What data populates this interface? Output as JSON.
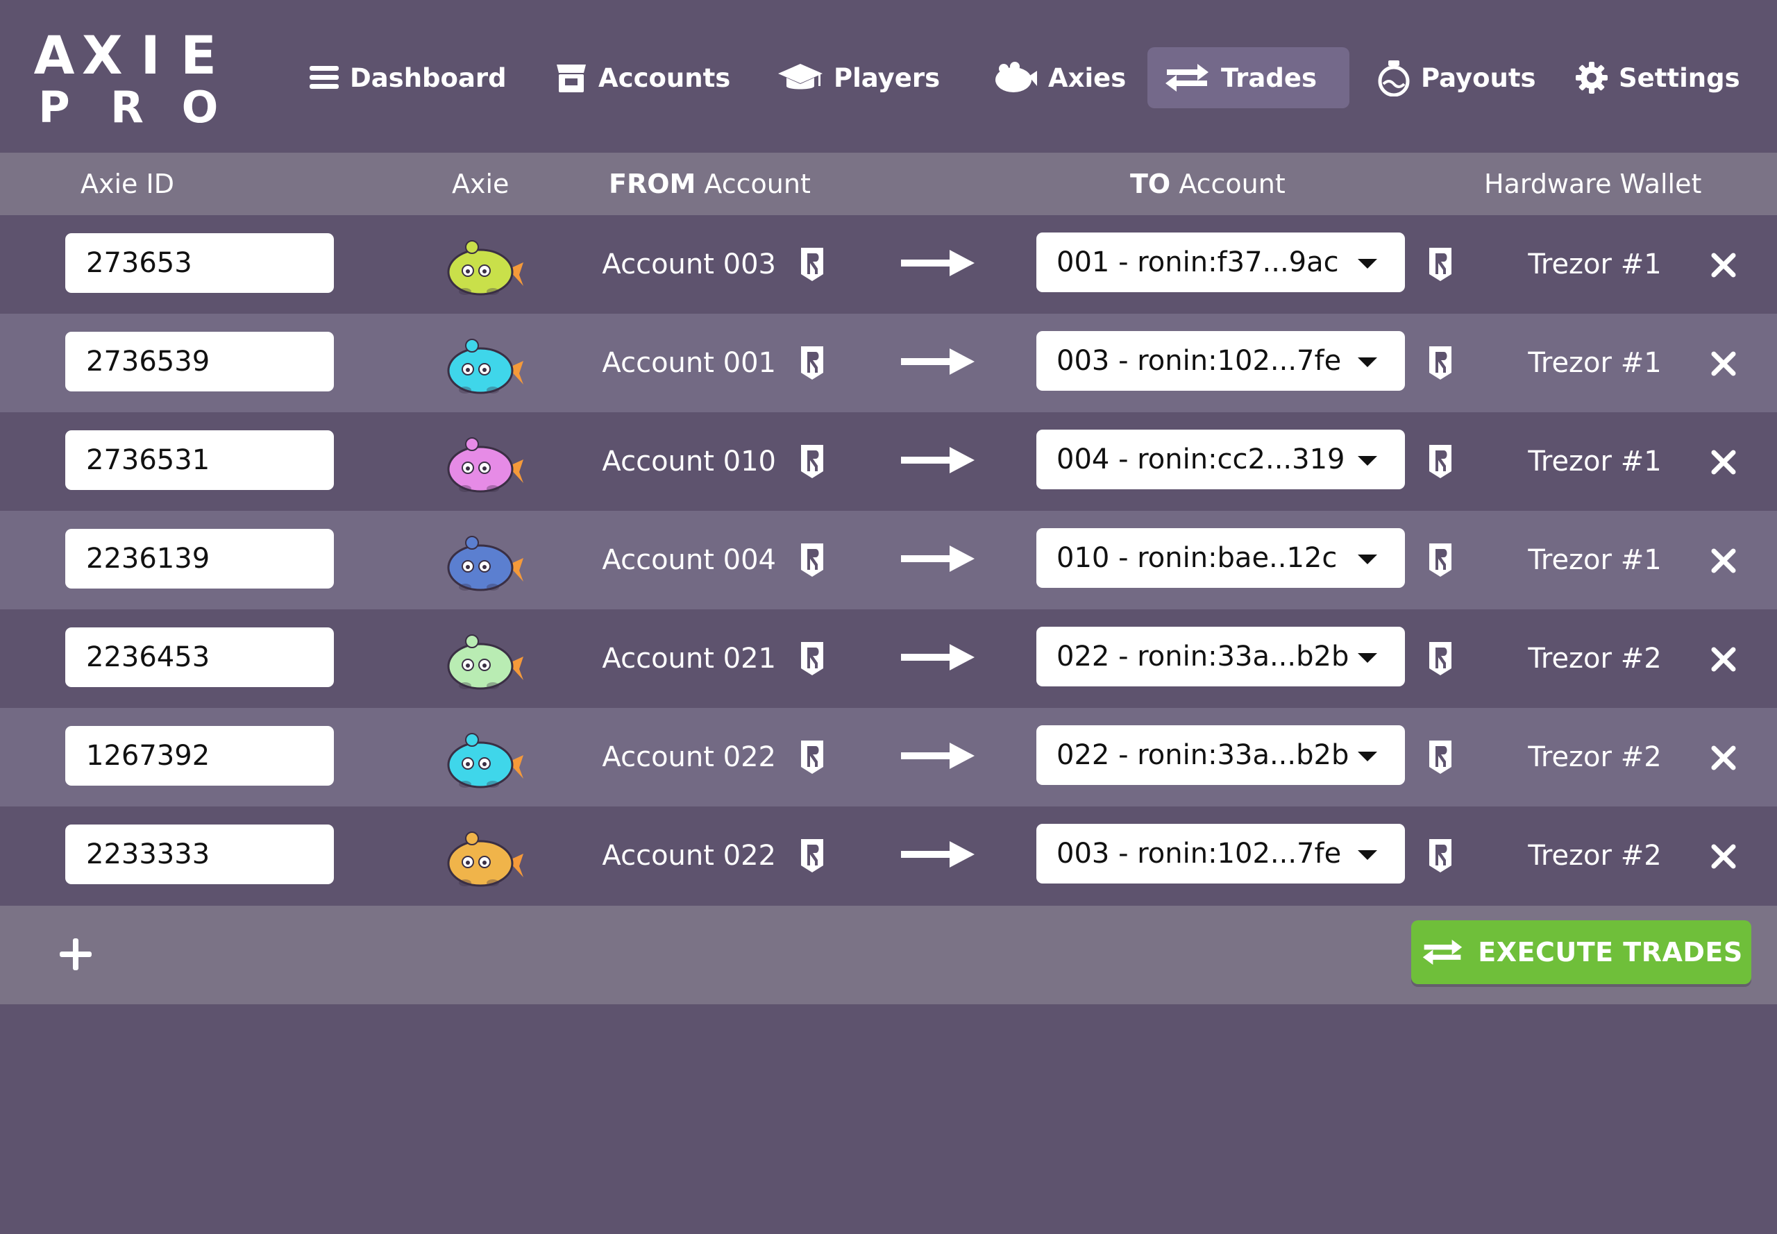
{
  "app": {
    "logo_line1": [
      "A",
      "X",
      "I",
      "E"
    ],
    "logo_line2": [
      "P",
      "R",
      "O"
    ]
  },
  "nav": [
    {
      "label": "Dashboard",
      "icon": "menu-icon",
      "active": false
    },
    {
      "label": "Accounts",
      "icon": "store-icon",
      "active": false
    },
    {
      "label": "Players",
      "icon": "graduation-cap-icon",
      "active": false
    },
    {
      "label": "Axies",
      "icon": "axie-icon",
      "active": false
    },
    {
      "label": "Trades",
      "icon": "swap-arrows-icon",
      "active": true
    },
    {
      "label": "Payouts",
      "icon": "potion-icon",
      "active": false
    },
    {
      "label": "Settings",
      "icon": "gear-icon",
      "active": false
    }
  ],
  "table": {
    "headers": {
      "axie_id": "Axie ID",
      "axie": "Axie",
      "from_bold": "FROM",
      "from_rest": " Account",
      "to_bold": "TO",
      "to_rest": " Account",
      "wallet": "Hardware Wallet"
    },
    "rows": [
      {
        "axie_id": "273653",
        "axie_color": "#c9e04a",
        "from": "Account 003",
        "to": "001 - ronin:f37...9ac",
        "wallet": "Trezor #1"
      },
      {
        "axie_id": "2736539",
        "axie_color": "#3fd6ea",
        "from": "Account 001",
        "to": "003 - ronin:102...7fe",
        "wallet": "Trezor #1"
      },
      {
        "axie_id": "2736531",
        "axie_color": "#e68be6",
        "from": "Account 010",
        "to": "004 - ronin:cc2...319",
        "wallet": "Trezor #1"
      },
      {
        "axie_id": "2236139",
        "axie_color": "#5b7fd0",
        "from": "Account 004",
        "to": "010 - ronin:bae..12c",
        "wallet": "Trezor #1"
      },
      {
        "axie_id": "2236453",
        "axie_color": "#b9ecb3",
        "from": "Account 021",
        "to": "022 - ronin:33a...b2b",
        "wallet": "Trezor #2"
      },
      {
        "axie_id": "1267392",
        "axie_color": "#3fd6ea",
        "from": "Account 022",
        "to": "022 - ronin:33a...b2b",
        "wallet": "Trezor #2"
      },
      {
        "axie_id": "2233333",
        "axie_color": "#f0b44a",
        "from": "Account 022",
        "to": "003 - ronin:102...7fe",
        "wallet": "Trezor #2"
      }
    ]
  },
  "footer": {
    "execute_label": "EXECUTE TRADES",
    "add_icon": "plus-icon"
  },
  "colors": {
    "background": "#5e536e",
    "header_row": "#7b7386",
    "alt_row": "#736a84",
    "active_tab": "#74698a",
    "execute": "#6fbf3a"
  }
}
